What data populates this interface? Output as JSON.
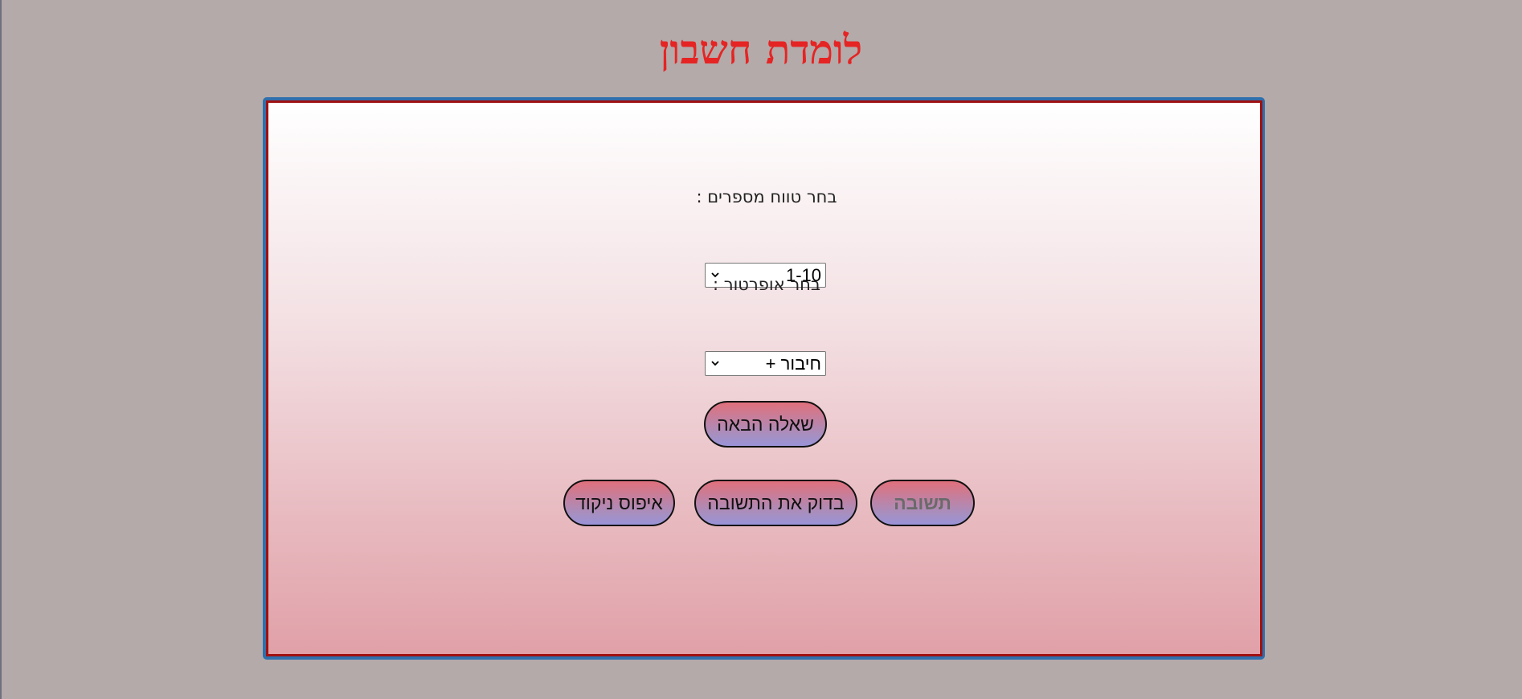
{
  "page": {
    "title": "לומדת חשבון"
  },
  "form": {
    "range_label": "בחר טווח מספרים :",
    "range_selected": "1-10",
    "operator_label": "בחר אופרטור :",
    "operator_selected": "חיבור +"
  },
  "buttons": {
    "next_question": "שאלה הבאה",
    "answer": "תשובה",
    "check_answer": "בדוק את התשובה",
    "reset_score": "איפוס ניקוד"
  },
  "icons": {
    "select_arrow": "chevron-down-icon"
  },
  "colors": {
    "background": "#b3aaa9",
    "title": "#e52424",
    "card_border_outer": "#2f6fad",
    "card_border_inner": "#a01010",
    "button_gradient_top": "#e0707c",
    "button_gradient_bottom": "#9a93d8"
  }
}
